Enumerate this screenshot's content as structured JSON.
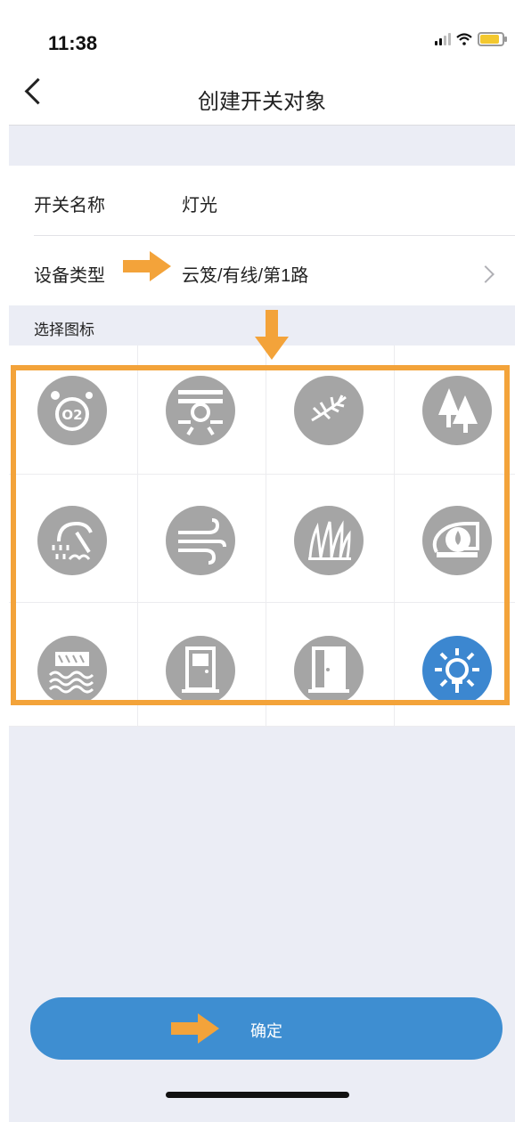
{
  "status_bar": {
    "time": "11:38"
  },
  "nav": {
    "title": "创建开关对象"
  },
  "form": {
    "switch_name": {
      "label": "开关名称",
      "value": "灯光"
    },
    "device_type": {
      "label": "设备类型",
      "value": "云笈/有线/第1路"
    }
  },
  "icons_section": {
    "label": "选择图标",
    "icons": [
      {
        "name": "oxygen-icon",
        "selected": false
      },
      {
        "name": "heater-icon",
        "selected": false
      },
      {
        "name": "plant-icon",
        "selected": false
      },
      {
        "name": "forest-icon",
        "selected": false
      },
      {
        "name": "sprinkler-icon",
        "selected": false
      },
      {
        "name": "wind-icon",
        "selected": false
      },
      {
        "name": "grass-icon",
        "selected": false
      },
      {
        "name": "water-roll-icon",
        "selected": false
      },
      {
        "name": "water-curtain-icon",
        "selected": false
      },
      {
        "name": "door-icon",
        "selected": false
      },
      {
        "name": "open-door-icon",
        "selected": false
      },
      {
        "name": "light-icon",
        "selected": true
      }
    ]
  },
  "confirm_button": {
    "label": "确定"
  },
  "colors": {
    "accent_blue": "#3e8ed1",
    "icon_gray": "#a5a5a5",
    "highlight_orange": "#f3a33a",
    "background": "#ebedf5"
  }
}
